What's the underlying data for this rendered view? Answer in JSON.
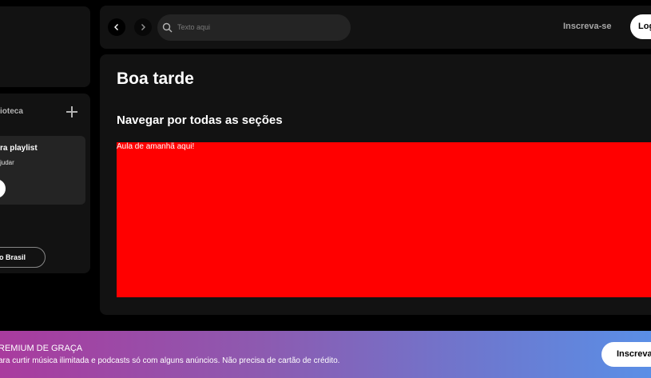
{
  "sidebar": {
    "library_title": "ioteca",
    "playlist_card": {
      "title": "ra playlist",
      "subtitle": "judar"
    },
    "language_button": "lo Brasil"
  },
  "topbar": {
    "search_placeholder": "Texto aqui",
    "signup_label": "Inscreva-se",
    "login_label": "Log"
  },
  "main": {
    "greeting": "Boa tarde",
    "section_title": "Navegar por todas as seções",
    "red_box_text": "Aula de amanhã aqui!",
    "red_box_color": "#ff0000"
  },
  "banner": {
    "title": "REMIUM DE GRAÇA",
    "subtitle": "ara curtir música ilimitada e podcasts só com alguns anúncios. Não precisa de cartão de crédito.",
    "button_label": "Inscreva"
  }
}
